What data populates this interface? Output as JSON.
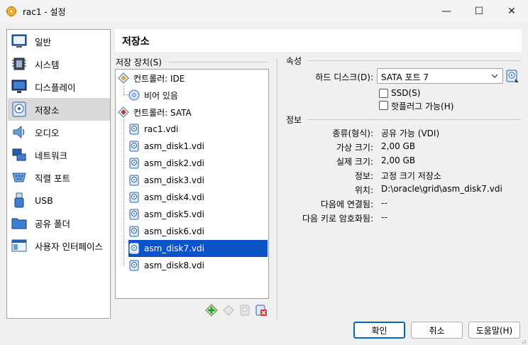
{
  "window": {
    "title": "rac1 - 설정",
    "minimize_glyph": "—",
    "maximize_glyph": "☐",
    "close_glyph": "✕"
  },
  "sidebar": {
    "items": [
      {
        "label": "일반",
        "icon": "general-icon"
      },
      {
        "label": "시스템",
        "icon": "chip-icon"
      },
      {
        "label": "디스플레이",
        "icon": "monitor-icon"
      },
      {
        "label": "저장소",
        "icon": "disk-icon",
        "selected": true
      },
      {
        "label": "오디오",
        "icon": "speaker-icon"
      },
      {
        "label": "네트워크",
        "icon": "network-icon"
      },
      {
        "label": "직렬 포트",
        "icon": "serial-port-icon"
      },
      {
        "label": "USB",
        "icon": "usb-icon"
      },
      {
        "label": "공유 폴더",
        "icon": "folder-icon"
      },
      {
        "label": "사용자 인터페이스",
        "icon": "ui-icon"
      }
    ]
  },
  "page": {
    "title": "저장소"
  },
  "storage": {
    "section_label": "저장 장치(S)",
    "controllers": [
      {
        "label": "컨트롤러: IDE",
        "devices": [
          {
            "label": "비어 있음",
            "type": "optical"
          }
        ]
      },
      {
        "label": "컨트롤러: SATA",
        "devices": [
          {
            "label": "rac1.vdi",
            "type": "hdd"
          },
          {
            "label": "asm_disk1.vdi",
            "type": "hdd"
          },
          {
            "label": "asm_disk2.vdi",
            "type": "hdd"
          },
          {
            "label": "asm_disk3.vdi",
            "type": "hdd"
          },
          {
            "label": "asm_disk4.vdi",
            "type": "hdd"
          },
          {
            "label": "asm_disk5.vdi",
            "type": "hdd"
          },
          {
            "label": "asm_disk6.vdi",
            "type": "hdd"
          },
          {
            "label": "asm_disk7.vdi",
            "type": "hdd",
            "selected": true
          },
          {
            "label": "asm_disk8.vdi",
            "type": "hdd"
          }
        ]
      }
    ]
  },
  "attributes": {
    "section_label": "속성",
    "hard_disk_label": "하드 디스크(D):",
    "hard_disk_value": "SATA 포트 7",
    "ssd_label": "SSD(S)",
    "ssd_checked": false,
    "hotplug_label": "핫플러그 가능(H)",
    "hotplug_checked": false
  },
  "info": {
    "section_label": "정보",
    "rows": [
      {
        "label": "종류(형식):",
        "value": "공유 가능 (VDI)"
      },
      {
        "label": "가상 크기:",
        "value": "2,00 GB"
      },
      {
        "label": "실제 크기:",
        "value": "2,00 GB"
      },
      {
        "label": "정보:",
        "value": "고정 크기 저장소"
      },
      {
        "label": "위치:",
        "value": "D:\\oracle\\grid\\asm_disk7.vdi"
      },
      {
        "label": "다음에 연결됨:",
        "value": "--"
      },
      {
        "label": "다음 키로 암호화됨:",
        "value": "--"
      }
    ]
  },
  "buttons": {
    "ok": "확인",
    "cancel": "취소",
    "help": "도움말(H)"
  },
  "colors": {
    "selection": "#0a53c8",
    "sidebar_selected": "#dadada",
    "accent_border": "#0067c0"
  }
}
